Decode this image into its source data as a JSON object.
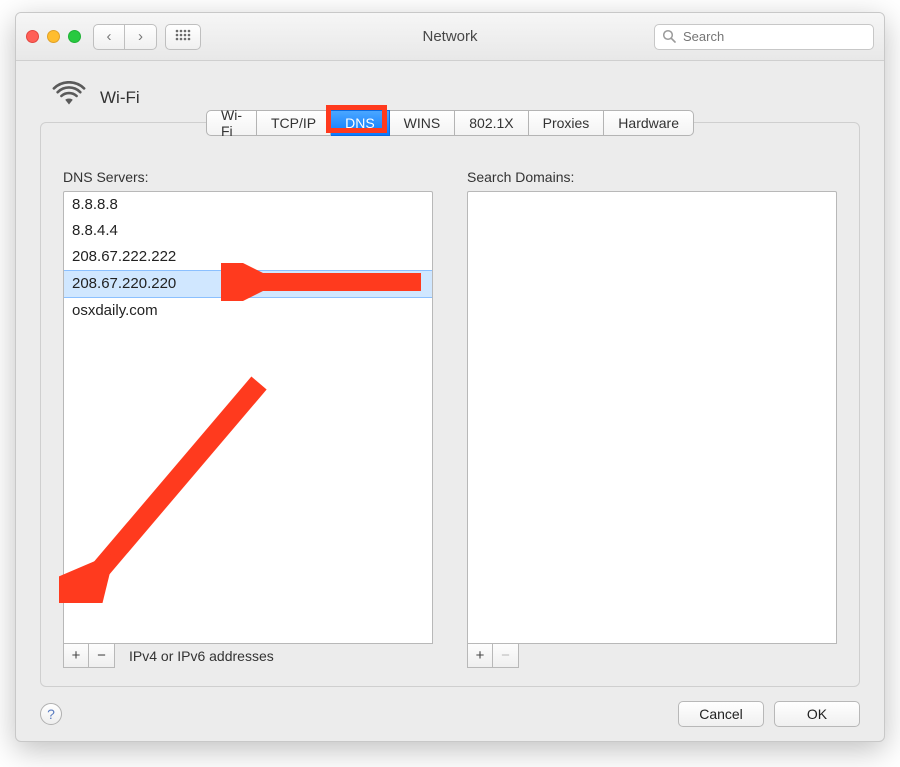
{
  "window": {
    "title": "Network"
  },
  "search": {
    "placeholder": "Search"
  },
  "heading": {
    "label": "Wi-Fi"
  },
  "tabs": [
    {
      "label": "Wi-Fi",
      "selected": false
    },
    {
      "label": "TCP/IP",
      "selected": false
    },
    {
      "label": "DNS",
      "selected": true
    },
    {
      "label": "WINS",
      "selected": false
    },
    {
      "label": "802.1X",
      "selected": false
    },
    {
      "label": "Proxies",
      "selected": false
    },
    {
      "label": "Hardware",
      "selected": false
    }
  ],
  "dns": {
    "label": "DNS Servers:",
    "items": [
      "8.8.8.8",
      "8.8.4.4",
      "208.67.222.222",
      "208.67.220.220",
      "osxdaily.com"
    ],
    "selected_index": 3,
    "hint": "IPv4 or IPv6 addresses"
  },
  "search_domains": {
    "label": "Search Domains:"
  },
  "buttons": {
    "plus": "+",
    "minus": "−",
    "cancel": "Cancel",
    "ok": "OK",
    "help": "?"
  }
}
